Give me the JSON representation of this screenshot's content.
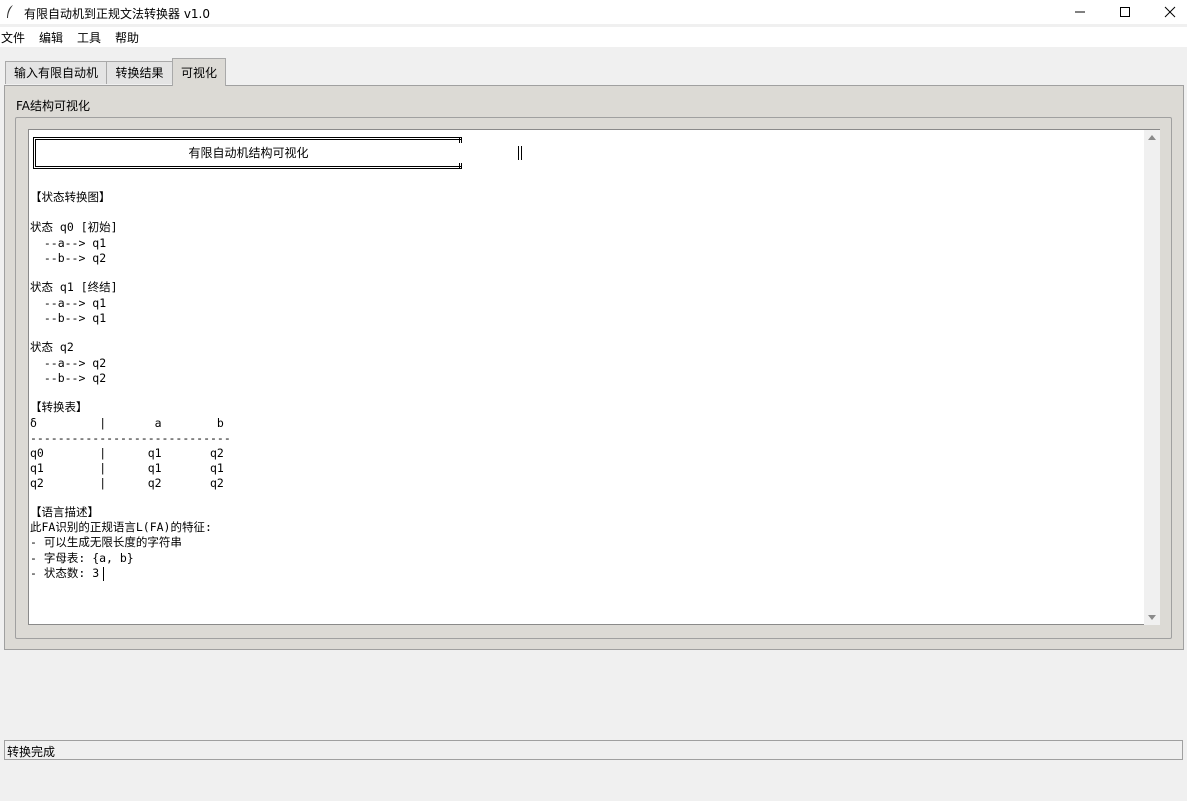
{
  "window": {
    "title": "有限自动机到正规文法转换器 v1.0",
    "minimize_glyph": "—",
    "maximize_glyph": "☐",
    "close_glyph": "✕"
  },
  "menu": {
    "file": "文件",
    "edit": "编辑",
    "tools": "工具",
    "help": "帮助"
  },
  "tabs": {
    "input": "输入有限自动机",
    "result": "转换结果",
    "visualize": "可视化",
    "active": "可视化"
  },
  "group": {
    "label": "FA结构可视化"
  },
  "visualization": {
    "header": "有限自动机结构可视化",
    "diagram_heading": "【状态转换图】",
    "states": [
      {
        "label": "状态 q0 [初始]",
        "transitions": [
          "  --a--> q1",
          "  --b--> q2"
        ]
      },
      {
        "label": "状态 q1 [终结]",
        "transitions": [
          "  --a--> q1",
          "  --b--> q1"
        ]
      },
      {
        "label": "状态 q2",
        "transitions": [
          "  --a--> q2",
          "  --b--> q2"
        ]
      }
    ],
    "table_heading": "【转换表】",
    "table_header": "δ         |       a        b",
    "table_separator": "-----------------------------",
    "table_rows": [
      "q0        |      q1       q2",
      "q1        |      q1       q1",
      "q2        |      q2       q2"
    ],
    "lang_heading": "【语言描述】",
    "lang_lines": [
      "此FA识别的正规语言L(FA)的特征:",
      "- 可以生成无限长度的字符串",
      "- 字母表: {a, b}",
      "- 状态数: 3"
    ]
  },
  "status": {
    "text": "转换完成"
  }
}
